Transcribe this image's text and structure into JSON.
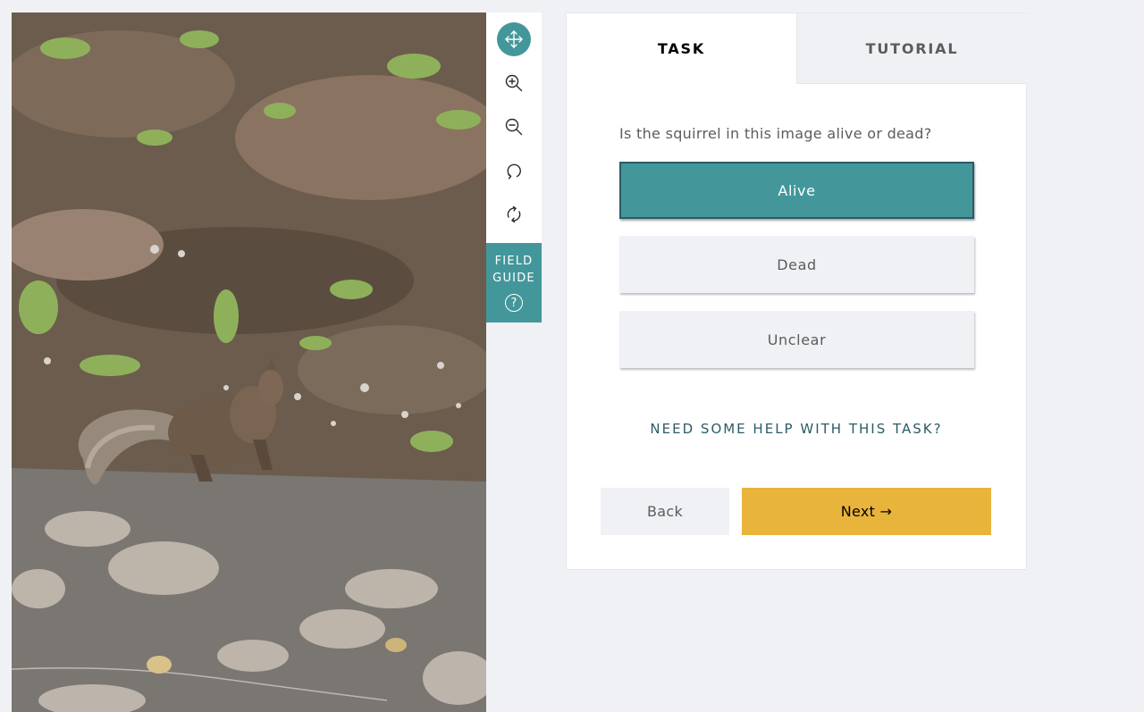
{
  "subject": {
    "image_icon": "squirrel-photo",
    "palette": {
      "ground": "#6b5c4d",
      "pavement": "#7a7671",
      "sunlight": "#c9bfb5",
      "foliage": "#8fb05a"
    }
  },
  "toolbar": {
    "tools": [
      {
        "icon": "move-icon",
        "active": true
      },
      {
        "icon": "zoom-in-icon",
        "active": false
      },
      {
        "icon": "zoom-out-icon",
        "active": false
      },
      {
        "icon": "rotate-icon",
        "active": false
      },
      {
        "icon": "reset-icon",
        "active": false
      }
    ],
    "field_guide": {
      "line1": "FIELD",
      "line2": "GUIDE",
      "help_glyph": "?"
    }
  },
  "tabs": {
    "task": "TASK",
    "tutorial": "TUTORIAL",
    "active": "task"
  },
  "task": {
    "question": "Is the squirrel in this image alive or dead?",
    "answers": [
      {
        "label": "Alive",
        "selected": true
      },
      {
        "label": "Dead",
        "selected": false
      },
      {
        "label": "Unclear",
        "selected": false
      }
    ],
    "help_link": "NEED SOME HELP WITH THIS TASK?",
    "back_label": "Back",
    "next_label": "Next →"
  },
  "colors": {
    "accent": "#43979b",
    "accent_dark": "#2b5c66",
    "next_button": "#e9b43b",
    "page_background": "#eff1f5"
  }
}
